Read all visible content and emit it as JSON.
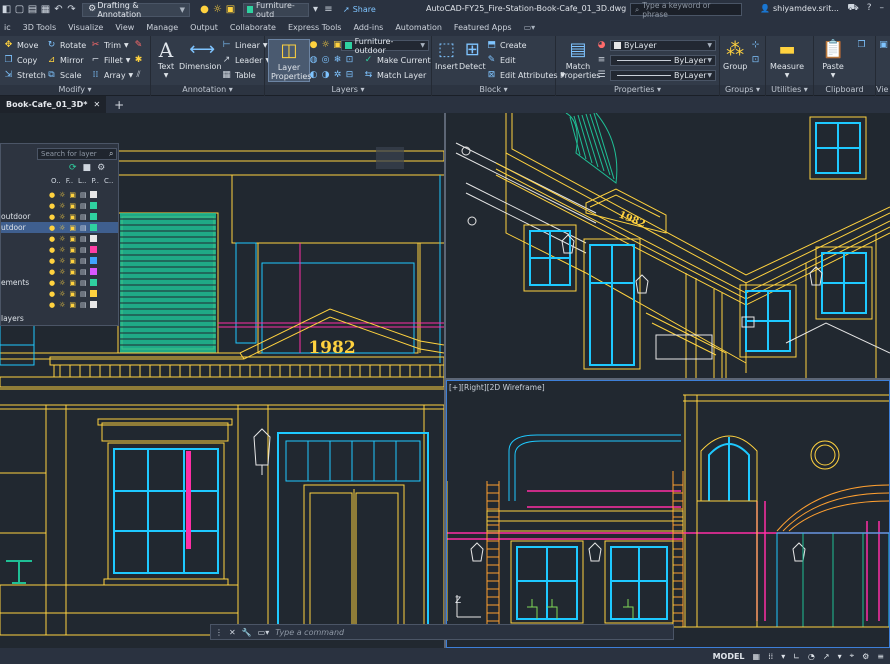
{
  "titlebar": {
    "workspace": "Drafting & Annotation",
    "layer_mini": "Furniture-outd",
    "share": "Share",
    "document_title": "AutoCAD-FY25_Fire-Station-Book-Cafe_01_3D.dwg",
    "search_placeholder": "Type a keyword or phrase",
    "user": "shiyamdev.srit..."
  },
  "menu": [
    "ic",
    "3D Tools",
    "Visualize",
    "View",
    "Manage",
    "Output",
    "Collaborate",
    "Express Tools",
    "Add-ins",
    "Automation",
    "Featured Apps"
  ],
  "ribbon": {
    "modify": {
      "title": "Modify",
      "items": [
        "Move",
        "Rotate",
        "Trim",
        "Copy",
        "Mirror",
        "Fillet",
        "Stretch",
        "Scale",
        "Array"
      ]
    },
    "annotation": {
      "title": "Annotation",
      "text": "Text",
      "dimension": "Dimension",
      "linear": "Linear",
      "leader": "Leader",
      "table": "Table"
    },
    "layers": {
      "title": "Layers",
      "layer_properties": "Layer Properties",
      "current_layer": "Furniture-outdoor",
      "make_current": "Make Current",
      "match_layer": "Match Layer"
    },
    "block": {
      "title": "Block",
      "insert": "Insert",
      "detect": "Detect",
      "create": "Create",
      "edit": "Edit",
      "edit_attributes": "Edit Attributes"
    },
    "properties": {
      "title": "Properties",
      "match_properties": "Match Properties",
      "color": "ByLayer",
      "linetype": "ByLayer",
      "lineweight": "ByLayer"
    },
    "groups": {
      "title": "Groups",
      "group": "Group"
    },
    "utilities": {
      "title": "Utilities",
      "measure": "Measure"
    },
    "clipboard": {
      "title": "Clipboard",
      "paste": "Paste"
    },
    "view": {
      "title": "Vie"
    }
  },
  "doctab": {
    "label": "Book-Cafe_01_3D*",
    "close": "✕"
  },
  "viewport_br_label": "[+][Right][2D Wireframe]",
  "building_year": "1982",
  "layer_palette": {
    "search_placeholder": "Search for layer",
    "headers": [
      "O..",
      "F..",
      "L..",
      "P..",
      "C.."
    ],
    "rows": [
      {
        "name": "",
        "color": "#e6e6e6",
        "selected": false
      },
      {
        "name": "",
        "color": "#2fd1a0",
        "selected": false
      },
      {
        "name": "outdoor",
        "color": "#2fd1a0",
        "selected": false
      },
      {
        "name": "utdoor",
        "color": "#2fd1a0",
        "selected": true
      },
      {
        "name": "",
        "color": "#e8e8e8",
        "selected": false
      },
      {
        "name": "",
        "color": "#ff3ea5",
        "selected": false
      },
      {
        "name": "",
        "color": "#3fa4ff",
        "selected": false
      },
      {
        "name": "",
        "color": "#d957ff",
        "selected": false
      },
      {
        "name": "ements",
        "color": "#2fd1a0",
        "selected": false
      },
      {
        "name": "",
        "color": "#ffd23f",
        "selected": false
      },
      {
        "name": "",
        "color": "#e8e8e8",
        "selected": false
      }
    ],
    "footer": "layers"
  },
  "command": {
    "placeholder": "Type a command"
  },
  "status": {
    "model": "MODEL",
    "axis": "Z"
  },
  "colors": {
    "yellow": "#ffd23f",
    "cyan": "#1ec9ff",
    "teal": "#1fbf95",
    "magenta": "#ff2ea6",
    "blue": "#2f7de1",
    "white": "#e6e6e6"
  }
}
